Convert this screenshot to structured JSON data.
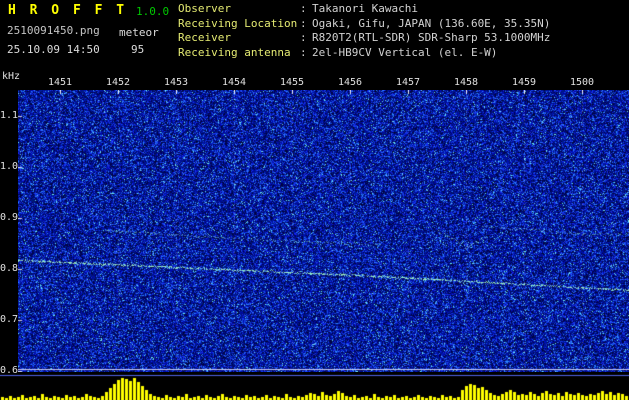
{
  "app": {
    "title": "H R O F F T",
    "version": "1.0.0",
    "filename": "2510091450.png",
    "mode": "meteor",
    "datetime": "25.10.09 14:50",
    "count": "95"
  },
  "info": {
    "separator": ":",
    "rows": [
      {
        "label": "Observer",
        "value": "Takanori Kawachi"
      },
      {
        "label": "Receiving Location",
        "value": "Ogaki, Gifu, JAPAN (136.60E, 35.35N)"
      },
      {
        "label": "Receiver",
        "value": "R820T2(RTL-SDR) SDR-Sharp 53.1000MHz"
      },
      {
        "label": "Receiving antenna",
        "value": "2el-HB9CV Vertical (el. E-W)"
      }
    ]
  },
  "spectrogram": {
    "y_axis": {
      "unit": "kHz",
      "labels": [
        "1.1",
        "1.0",
        "0.9",
        "0.8",
        "0.7",
        "0.6"
      ]
    },
    "x_axis": {
      "labels": [
        "1451",
        "1452",
        "1453",
        "1454",
        "1455",
        "1456",
        "1457",
        "1458",
        "1459",
        "1500"
      ]
    },
    "colors": {
      "noise_base": "#0000a0",
      "trace": "#a0ffc8",
      "bars": "#ffff00",
      "grid": "#ffffff"
    },
    "traces": [
      {
        "name": "carrier-trace-0.8khz",
        "color": "#a8ffc8",
        "density": 0.95,
        "alpha": 0.65,
        "jitter": 1.2,
        "bright": true,
        "points": [
          [
            0,
            170
          ],
          [
            90,
            174
          ],
          [
            180,
            178
          ],
          [
            270,
            182
          ],
          [
            360,
            186
          ],
          [
            450,
            191
          ],
          [
            540,
            196
          ],
          [
            611,
            200
          ]
        ]
      },
      {
        "name": "trace-0.9khz-left",
        "color": "#90e8c0",
        "density": 0.55,
        "alpha": 0.45,
        "jitter": 1.0,
        "bright": false,
        "points": [
          [
            88,
            140
          ],
          [
            180,
            146
          ],
          [
            280,
            151
          ],
          [
            362,
            154
          ]
        ]
      },
      {
        "name": "meteor-echo-wiggle",
        "color": "#a0f0d0",
        "density": 0.7,
        "alpha": 0.55,
        "jitter": 1.2,
        "bright": false,
        "points": [
          [
            420,
            141
          ],
          [
            438,
            150
          ],
          [
            448,
            158
          ],
          [
            458,
            151
          ],
          [
            468,
            146
          ]
        ]
      },
      {
        "name": "trace-0.9khz-right",
        "color": "#90e8c0",
        "density": 0.55,
        "alpha": 0.45,
        "jitter": 1.0,
        "bright": false,
        "points": [
          [
            460,
            136
          ],
          [
            525,
            140
          ],
          [
            565,
            144
          ],
          [
            611,
            143
          ]
        ]
      }
    ],
    "activity_bars": [
      3,
      2,
      4,
      2,
      3,
      5,
      2,
      3,
      4,
      2,
      6,
      3,
      2,
      4,
      3,
      2,
      5,
      3,
      4,
      2,
      3,
      6,
      4,
      3,
      2,
      4,
      8,
      12,
      16,
      20,
      22,
      21,
      19,
      22,
      18,
      14,
      10,
      6,
      4,
      3,
      2,
      5,
      3,
      2,
      4,
      3,
      6,
      2,
      3,
      4,
      2,
      5,
      3,
      2,
      4,
      6,
      3,
      2,
      4,
      3,
      2,
      5,
      3,
      4,
      2,
      3,
      5,
      2,
      4,
      3,
      2,
      6,
      3,
      2,
      4,
      3,
      5,
      7,
      6,
      4,
      8,
      5,
      4,
      6,
      9,
      7,
      4,
      3,
      5,
      2,
      3,
      4,
      2,
      6,
      3,
      2,
      4,
      3,
      5,
      2,
      3,
      4,
      2,
      3,
      5,
      3,
      2,
      4,
      3,
      2,
      5,
      3,
      4,
      2,
      3,
      10,
      14,
      16,
      15,
      12,
      13,
      10,
      7,
      5,
      4,
      6,
      8,
      10,
      8,
      5,
      6,
      5,
      8,
      6,
      4,
      7,
      9,
      6,
      5,
      7,
      4,
      8,
      6,
      5,
      7,
      5,
      4,
      6,
      5,
      7,
      9,
      6,
      8,
      5,
      7,
      6,
      4
    ]
  }
}
